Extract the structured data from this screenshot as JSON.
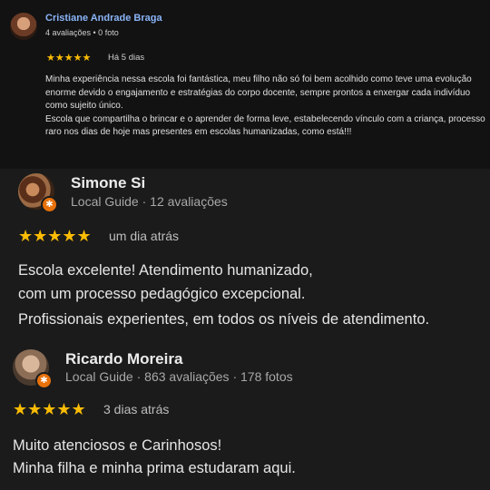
{
  "reviews": [
    {
      "name": "Cristiane Andrade Braga",
      "meta": "4 avaliações • 0 foto",
      "stars": "★★★★★",
      "when": "Há 5 dias",
      "lines": [
        "Minha experiência nessa escola foi fantástica, meu filho não só foi bem acolhido como teve uma evolução enorme devido o engajamento e estratégias do corpo docente, sempre prontos a enxergar cada indivíduo como sujeito único.",
        "Escola que compartilha o brincar e o aprender de forma leve, estabelecendo vínculo com a criança, processo raro nos dias de hoje mas presentes em escolas humanizadas, como está!!!"
      ]
    },
    {
      "name": "Simone Si",
      "meta": "Local Guide · 12 avaliações",
      "stars": "★★★★★",
      "when": "um dia atrás",
      "lines": [
        "Escola excelente! Atendimento humanizado,",
        "com um processo pedagógico excepcional.",
        "Profissionais experientes, em todos os níveis de atendimento."
      ]
    },
    {
      "name": "Ricardo Moreira",
      "meta": "Local Guide · 863 avaliações · 178 fotos",
      "stars": "★★★★★",
      "when": "3 dias atrás",
      "lines": [
        "Muito atenciosos e Carinhosos!",
        "Minha filha e minha prima estudaram aqui."
      ]
    }
  ],
  "colors": {
    "star": "#fbbc04",
    "link_name": "#8ab4f8",
    "local_guide_badge": "#e8710a"
  },
  "icons": {
    "local_guide_badge": "star-badge-icon"
  }
}
